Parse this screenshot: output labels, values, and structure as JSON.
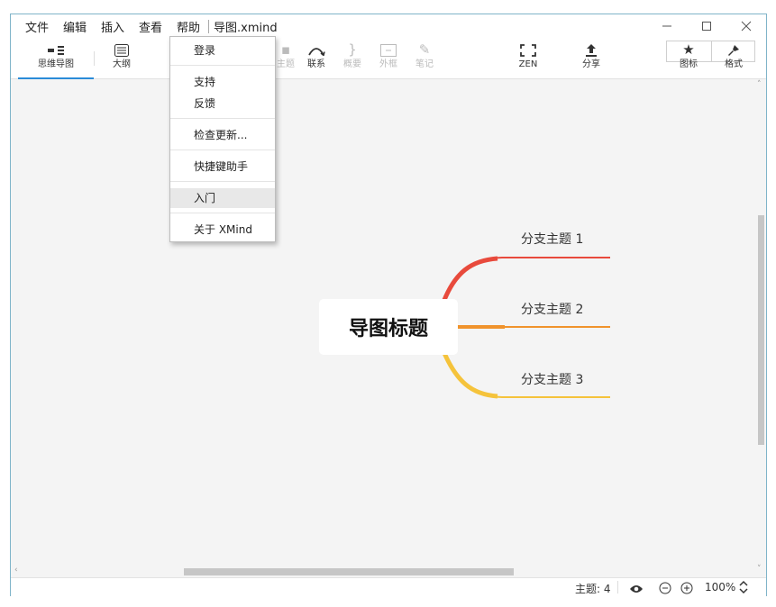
{
  "menubar": {
    "items": [
      "文件",
      "编辑",
      "插入",
      "查看",
      "帮助"
    ],
    "filename": "导图.xmind"
  },
  "window_controls": [
    "minimize-icon",
    "maximize-icon",
    "close-icon"
  ],
  "toolbar": {
    "mindmap_label": "思维导图",
    "outline_label": "大纲",
    "topic_label": "主题",
    "relation_label": "联系",
    "summary_label": "概要",
    "boundary_label": "外框",
    "note_label": "笔记",
    "zen_label": "ZEN",
    "share_label": "分享",
    "icons_label": "图标",
    "format_label": "格式"
  },
  "help_menu": {
    "items": [
      "登录",
      "支持",
      "反馈",
      "检查更新...",
      "快捷键助手",
      "入门",
      "关于 XMind"
    ],
    "highlighted": "入门"
  },
  "mindmap": {
    "central_topic": "导图标题",
    "branches": [
      "分支主题 1",
      "分支主题 2",
      "分支主题 3"
    ],
    "branch_colors": [
      "#e84a3c",
      "#f0932c",
      "#f5c33b"
    ]
  },
  "statusbar": {
    "topic_count": "主题: 4",
    "zoom": "100%"
  }
}
